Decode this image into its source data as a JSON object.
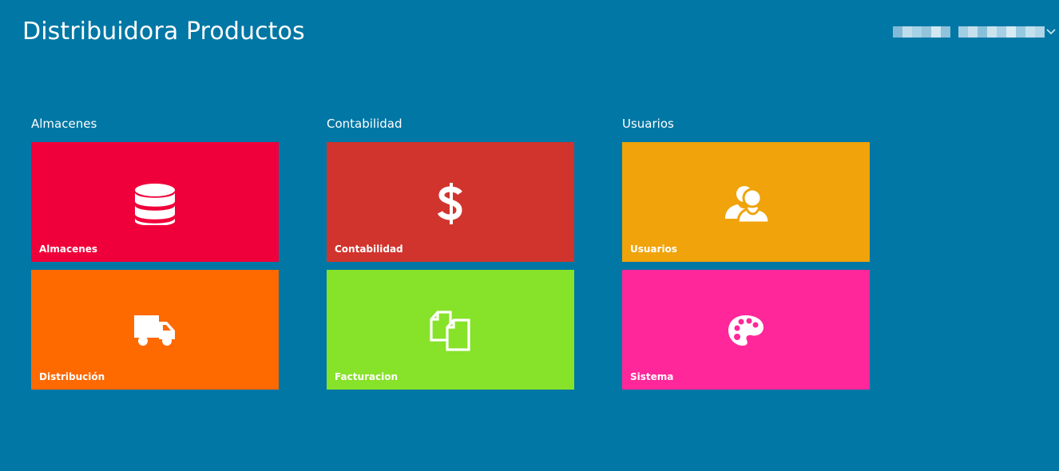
{
  "app": {
    "title": "Distribuidora Productos"
  },
  "header": {
    "user_menu_icon": "chevron-down-icon",
    "user_name_obscured": true
  },
  "colors": {
    "background": "#0077a5",
    "white": "#ffffff",
    "almacenes": "#f0003a",
    "distribucion": "#fe6900",
    "contabilidad": "#d1342d",
    "facturacion": "#87e22a",
    "usuarios": "#f0a30a",
    "sistema": "#ff2799"
  },
  "groups": [
    {
      "title": "Almacenes",
      "tiles": [
        {
          "label": "Almacenes",
          "icon": "database-icon",
          "color": "#f0003a"
        },
        {
          "label": "Distribución",
          "icon": "truck-icon",
          "color": "#fe6900"
        }
      ]
    },
    {
      "title": "Contabilidad",
      "tiles": [
        {
          "label": "Contabilidad",
          "icon": "dollar-icon",
          "color": "#d1342d"
        },
        {
          "label": "Facturacion",
          "icon": "documents-icon",
          "color": "#87e22a"
        }
      ]
    },
    {
      "title": "Usuarios",
      "tiles": [
        {
          "label": "Usuarios",
          "icon": "users-icon",
          "color": "#f0a30a"
        },
        {
          "label": "Sistema",
          "icon": "palette-icon",
          "color": "#ff2799"
        }
      ]
    }
  ]
}
